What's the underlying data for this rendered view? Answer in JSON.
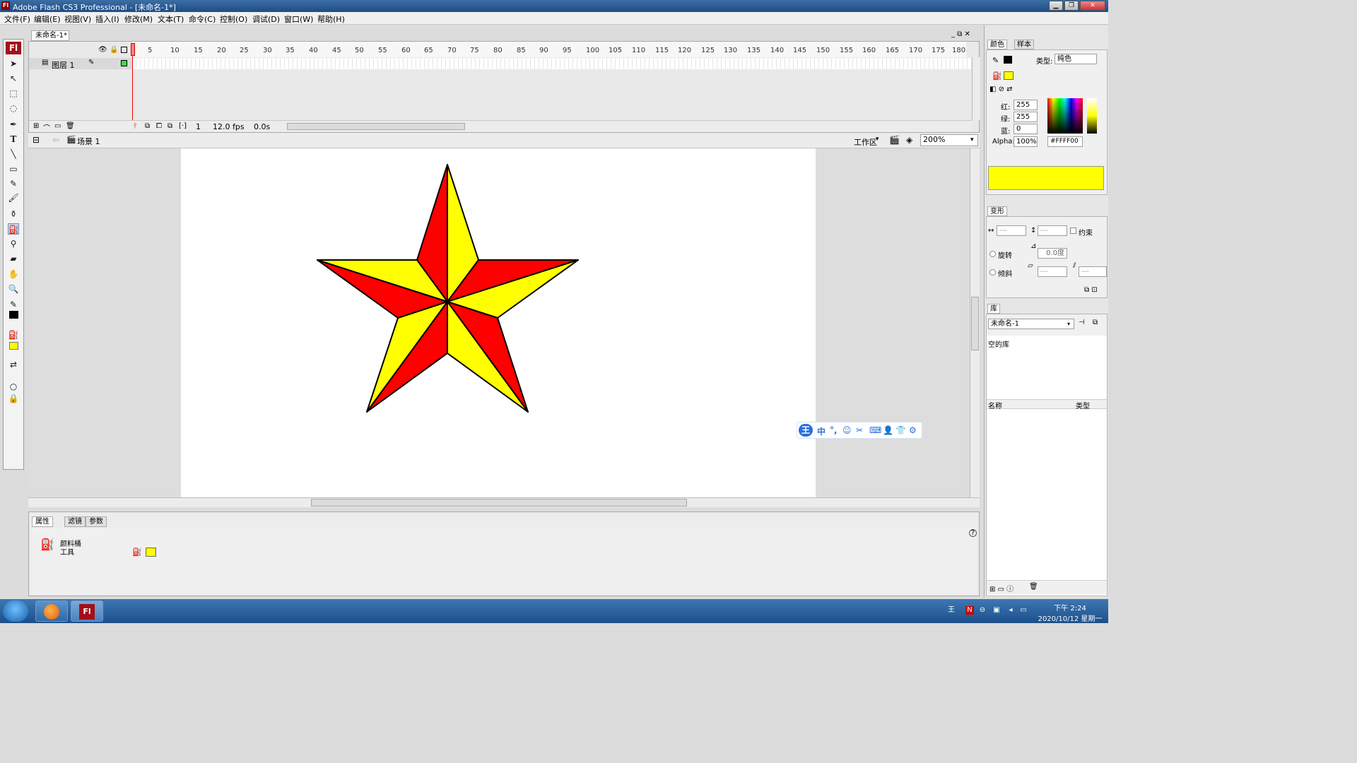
{
  "window": {
    "title": "Adobe Flash CS3 Professional - [未命名-1*]",
    "logo": "Fl"
  },
  "menu": [
    "文件(F)",
    "编辑(E)",
    "视图(V)",
    "插入(I)",
    "修改(M)",
    "文本(T)",
    "命令(C)",
    "控制(O)",
    "调试(D)",
    "窗口(W)",
    "帮助(H)"
  ],
  "doc_tab": "未命名-1*",
  "timeline": {
    "ruler_ticks": [
      "5",
      "10",
      "15",
      "20",
      "25",
      "30",
      "35",
      "40",
      "45",
      "50",
      "55",
      "60",
      "65",
      "70",
      "75",
      "80",
      "85",
      "90",
      "95",
      "100",
      "105",
      "110",
      "115",
      "120",
      "125",
      "130",
      "135",
      "140",
      "145",
      "150",
      "155",
      "160",
      "165",
      "170",
      "175",
      "180"
    ],
    "layer_name": "图层 1",
    "current_frame": "1",
    "fps": "12.0 fps",
    "time": "0.0s"
  },
  "editbar": {
    "scene": "场景 1",
    "workspace": "工作区",
    "zoom": "200%"
  },
  "ime": {
    "logo": "王",
    "items": [
      "中",
      "°,",
      "☺",
      "✂",
      "⌨",
      "👤",
      "👕",
      "⚙"
    ]
  },
  "properties": {
    "tabs": [
      "属性",
      "滤镜",
      "参数"
    ],
    "tool_name_line1": "颜料桶",
    "tool_name_line2": "工具",
    "fill_color": "#FFFF00"
  },
  "color_panel": {
    "tabs": [
      "颜色",
      "样本"
    ],
    "type_label": "类型:",
    "type_value": "纯色",
    "red_label": "红:",
    "red": "255",
    "green_label": "绿:",
    "green": "255",
    "blue_label": "蓝:",
    "blue": "0",
    "alpha_label": "Alpha:",
    "alpha": "100%",
    "hex": "#FFFF00"
  },
  "transform_panel": {
    "tab": "变形",
    "w_value": "---",
    "h_value": "---",
    "constrain": "约束",
    "rotate_label": "旋转",
    "rotate_value": "0.0度",
    "skew_label": "倾斜",
    "skew_value1": "---",
    "skew_value2": "---"
  },
  "library_panel": {
    "tab": "库",
    "doc": "未命名-1",
    "empty": "空的库",
    "col_name": "名称",
    "col_type": "类型"
  },
  "taskbar": {
    "flash_label": "Fl",
    "time": "下午 2:24",
    "date": "2020/10/12 星期一"
  },
  "colors": {
    "star_red": "#FF0000",
    "star_yellow": "#FFFF00",
    "accent": "#A3101A"
  }
}
